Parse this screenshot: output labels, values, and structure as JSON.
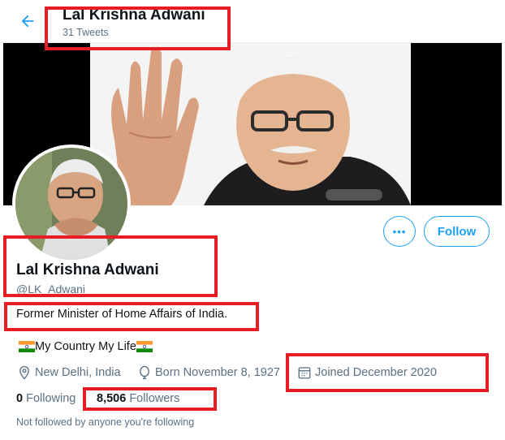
{
  "header": {
    "title": "Lal Krishna Adwani",
    "subtitle": "31 Tweets"
  },
  "profile": {
    "name": "Lal Krishna Adwani",
    "handle": "@LK_Adwani",
    "bio": "Former Minister of Home Affairs of India.",
    "tagline": "My Country My Life",
    "location": "New Delhi, India",
    "born": "Born November 8, 1927",
    "joined": "Joined December 2020",
    "following_count": "0",
    "following_label": "Following",
    "followers_count": "8,506",
    "followers_label": "Followers",
    "note": "Not followed by anyone you're following"
  },
  "actions": {
    "follow_label": "Follow",
    "more_label": "•••"
  },
  "colors": {
    "accent": "#1da1f2",
    "highlight": "#e81c24",
    "muted": "#5b7083"
  },
  "icons": [
    "back-arrow-icon",
    "more-icon",
    "location-icon",
    "birthday-icon",
    "calendar-icon",
    "india-flag-icon"
  ]
}
